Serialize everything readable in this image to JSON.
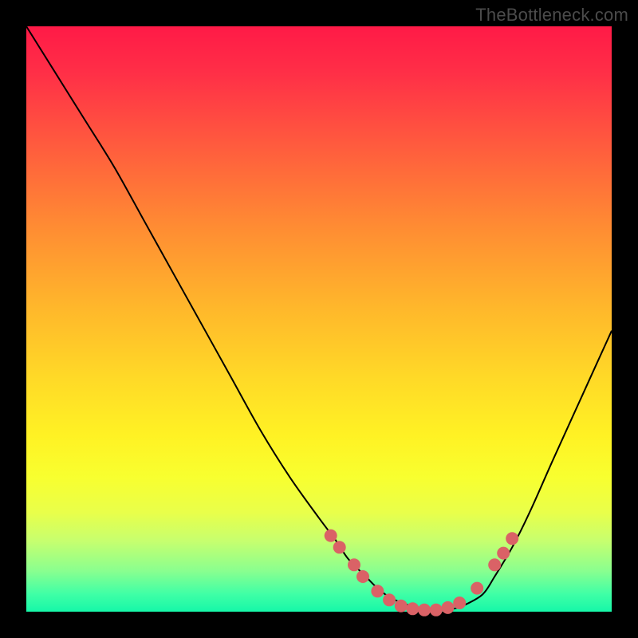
{
  "watermark": "TheBottleneck.com",
  "gradient_colors": {
    "top": "#ff1a47",
    "mid_upper": "#ff8b33",
    "mid": "#ffd927",
    "mid_lower": "#f8ff2f",
    "bottom": "#16f7a8"
  },
  "chart_data": {
    "type": "line",
    "title": "",
    "xlabel": "",
    "ylabel": "",
    "xlim": [
      0,
      100
    ],
    "ylim": [
      0,
      100
    ],
    "series": [
      {
        "name": "curve",
        "x": [
          0,
          5,
          10,
          15,
          20,
          25,
          30,
          35,
          40,
          45,
          50,
          53,
          55,
          58,
          60,
          62,
          65,
          68,
          70,
          73,
          75,
          78,
          80,
          83,
          86,
          90,
          95,
          100
        ],
        "y": [
          100,
          92,
          84,
          76,
          67,
          58,
          49,
          40,
          31,
          23,
          16,
          12,
          9,
          6,
          4,
          2.5,
          1.2,
          0.5,
          0.2,
          0.5,
          1.2,
          3,
          6,
          11,
          17,
          26,
          37,
          48
        ],
        "stroke": "#000000",
        "stroke_width": 2
      }
    ],
    "markers": {
      "name": "highlighted-points",
      "color": "#da6266",
      "radius": 8,
      "points": [
        {
          "x": 52,
          "y": 13
        },
        {
          "x": 53.5,
          "y": 11
        },
        {
          "x": 56,
          "y": 8
        },
        {
          "x": 57.5,
          "y": 6
        },
        {
          "x": 60,
          "y": 3.5
        },
        {
          "x": 62,
          "y": 2
        },
        {
          "x": 64,
          "y": 1
        },
        {
          "x": 66,
          "y": 0.5
        },
        {
          "x": 68,
          "y": 0.3
        },
        {
          "x": 70,
          "y": 0.3
        },
        {
          "x": 72,
          "y": 0.7
        },
        {
          "x": 74,
          "y": 1.5
        },
        {
          "x": 77,
          "y": 4
        },
        {
          "x": 80,
          "y": 8
        },
        {
          "x": 81.5,
          "y": 10
        },
        {
          "x": 83,
          "y": 12.5
        }
      ]
    }
  }
}
